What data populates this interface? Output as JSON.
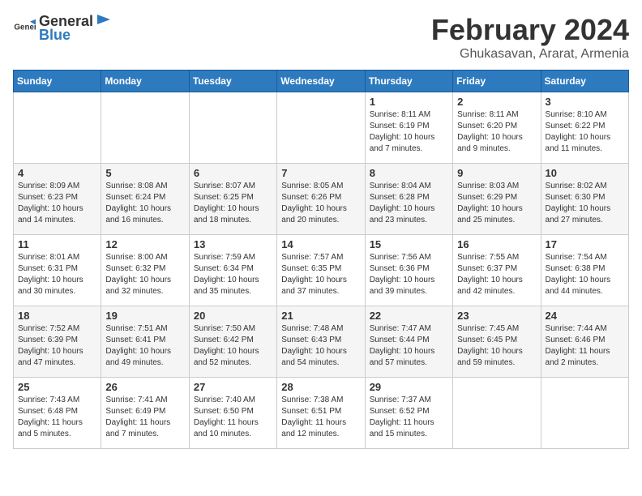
{
  "logo": {
    "text_general": "General",
    "text_blue": "Blue"
  },
  "header": {
    "month_year": "February 2024",
    "location": "Ghukasavan, Ararat, Armenia"
  },
  "days_of_week": [
    "Sunday",
    "Monday",
    "Tuesday",
    "Wednesday",
    "Thursday",
    "Friday",
    "Saturday"
  ],
  "weeks": [
    [
      {
        "day": "",
        "info": ""
      },
      {
        "day": "",
        "info": ""
      },
      {
        "day": "",
        "info": ""
      },
      {
        "day": "",
        "info": ""
      },
      {
        "day": "1",
        "info": "Sunrise: 8:11 AM\nSunset: 6:19 PM\nDaylight: 10 hours\nand 7 minutes."
      },
      {
        "day": "2",
        "info": "Sunrise: 8:11 AM\nSunset: 6:20 PM\nDaylight: 10 hours\nand 9 minutes."
      },
      {
        "day": "3",
        "info": "Sunrise: 8:10 AM\nSunset: 6:22 PM\nDaylight: 10 hours\nand 11 minutes."
      }
    ],
    [
      {
        "day": "4",
        "info": "Sunrise: 8:09 AM\nSunset: 6:23 PM\nDaylight: 10 hours\nand 14 minutes."
      },
      {
        "day": "5",
        "info": "Sunrise: 8:08 AM\nSunset: 6:24 PM\nDaylight: 10 hours\nand 16 minutes."
      },
      {
        "day": "6",
        "info": "Sunrise: 8:07 AM\nSunset: 6:25 PM\nDaylight: 10 hours\nand 18 minutes."
      },
      {
        "day": "7",
        "info": "Sunrise: 8:05 AM\nSunset: 6:26 PM\nDaylight: 10 hours\nand 20 minutes."
      },
      {
        "day": "8",
        "info": "Sunrise: 8:04 AM\nSunset: 6:28 PM\nDaylight: 10 hours\nand 23 minutes."
      },
      {
        "day": "9",
        "info": "Sunrise: 8:03 AM\nSunset: 6:29 PM\nDaylight: 10 hours\nand 25 minutes."
      },
      {
        "day": "10",
        "info": "Sunrise: 8:02 AM\nSunset: 6:30 PM\nDaylight: 10 hours\nand 27 minutes."
      }
    ],
    [
      {
        "day": "11",
        "info": "Sunrise: 8:01 AM\nSunset: 6:31 PM\nDaylight: 10 hours\nand 30 minutes."
      },
      {
        "day": "12",
        "info": "Sunrise: 8:00 AM\nSunset: 6:32 PM\nDaylight: 10 hours\nand 32 minutes."
      },
      {
        "day": "13",
        "info": "Sunrise: 7:59 AM\nSunset: 6:34 PM\nDaylight: 10 hours\nand 35 minutes."
      },
      {
        "day": "14",
        "info": "Sunrise: 7:57 AM\nSunset: 6:35 PM\nDaylight: 10 hours\nand 37 minutes."
      },
      {
        "day": "15",
        "info": "Sunrise: 7:56 AM\nSunset: 6:36 PM\nDaylight: 10 hours\nand 39 minutes."
      },
      {
        "day": "16",
        "info": "Sunrise: 7:55 AM\nSunset: 6:37 PM\nDaylight: 10 hours\nand 42 minutes."
      },
      {
        "day": "17",
        "info": "Sunrise: 7:54 AM\nSunset: 6:38 PM\nDaylight: 10 hours\nand 44 minutes."
      }
    ],
    [
      {
        "day": "18",
        "info": "Sunrise: 7:52 AM\nSunset: 6:39 PM\nDaylight: 10 hours\nand 47 minutes."
      },
      {
        "day": "19",
        "info": "Sunrise: 7:51 AM\nSunset: 6:41 PM\nDaylight: 10 hours\nand 49 minutes."
      },
      {
        "day": "20",
        "info": "Sunrise: 7:50 AM\nSunset: 6:42 PM\nDaylight: 10 hours\nand 52 minutes."
      },
      {
        "day": "21",
        "info": "Sunrise: 7:48 AM\nSunset: 6:43 PM\nDaylight: 10 hours\nand 54 minutes."
      },
      {
        "day": "22",
        "info": "Sunrise: 7:47 AM\nSunset: 6:44 PM\nDaylight: 10 hours\nand 57 minutes."
      },
      {
        "day": "23",
        "info": "Sunrise: 7:45 AM\nSunset: 6:45 PM\nDaylight: 10 hours\nand 59 minutes."
      },
      {
        "day": "24",
        "info": "Sunrise: 7:44 AM\nSunset: 6:46 PM\nDaylight: 11 hours\nand 2 minutes."
      }
    ],
    [
      {
        "day": "25",
        "info": "Sunrise: 7:43 AM\nSunset: 6:48 PM\nDaylight: 11 hours\nand 5 minutes."
      },
      {
        "day": "26",
        "info": "Sunrise: 7:41 AM\nSunset: 6:49 PM\nDaylight: 11 hours\nand 7 minutes."
      },
      {
        "day": "27",
        "info": "Sunrise: 7:40 AM\nSunset: 6:50 PM\nDaylight: 11 hours\nand 10 minutes."
      },
      {
        "day": "28",
        "info": "Sunrise: 7:38 AM\nSunset: 6:51 PM\nDaylight: 11 hours\nand 12 minutes."
      },
      {
        "day": "29",
        "info": "Sunrise: 7:37 AM\nSunset: 6:52 PM\nDaylight: 11 hours\nand 15 minutes."
      },
      {
        "day": "",
        "info": ""
      },
      {
        "day": "",
        "info": ""
      }
    ]
  ]
}
